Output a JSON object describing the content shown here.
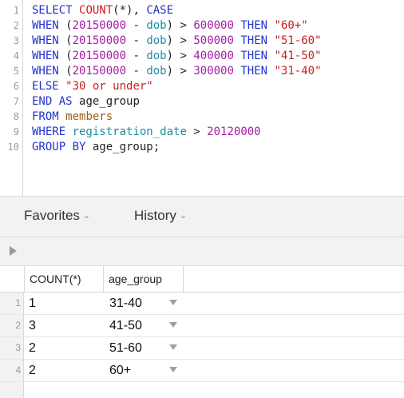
{
  "editor": {
    "line_numbers": [
      "1",
      "2",
      "3",
      "4",
      "5",
      "6",
      "7",
      "8",
      "9",
      "10"
    ],
    "lines": [
      [
        {
          "t": "SELECT ",
          "c": "kw"
        },
        {
          "t": "COUNT",
          "c": "fn"
        },
        {
          "t": "(*), ",
          "c": "op"
        },
        {
          "t": "CASE",
          "c": "kw"
        }
      ],
      [
        {
          "t": "WHEN ",
          "c": "kw"
        },
        {
          "t": "(",
          "c": "op"
        },
        {
          "t": "20150000",
          "c": "num"
        },
        {
          "t": " - ",
          "c": "op"
        },
        {
          "t": "dob",
          "c": "col"
        },
        {
          "t": ") > ",
          "c": "op"
        },
        {
          "t": "600000",
          "c": "num"
        },
        {
          "t": " THEN ",
          "c": "kw"
        },
        {
          "t": "\"60+\"",
          "c": "str"
        }
      ],
      [
        {
          "t": "WHEN ",
          "c": "kw"
        },
        {
          "t": "(",
          "c": "op"
        },
        {
          "t": "20150000",
          "c": "num"
        },
        {
          "t": " - ",
          "c": "op"
        },
        {
          "t": "dob",
          "c": "col"
        },
        {
          "t": ") > ",
          "c": "op"
        },
        {
          "t": "500000",
          "c": "num"
        },
        {
          "t": " THEN ",
          "c": "kw"
        },
        {
          "t": "\"51-60\"",
          "c": "str"
        }
      ],
      [
        {
          "t": "WHEN ",
          "c": "kw"
        },
        {
          "t": "(",
          "c": "op"
        },
        {
          "t": "20150000",
          "c": "num"
        },
        {
          "t": " - ",
          "c": "op"
        },
        {
          "t": "dob",
          "c": "col"
        },
        {
          "t": ") > ",
          "c": "op"
        },
        {
          "t": "400000",
          "c": "num"
        },
        {
          "t": " THEN ",
          "c": "kw"
        },
        {
          "t": "\"41-50\"",
          "c": "str"
        }
      ],
      [
        {
          "t": "WHEN ",
          "c": "kw"
        },
        {
          "t": "(",
          "c": "op"
        },
        {
          "t": "20150000",
          "c": "num"
        },
        {
          "t": " - ",
          "c": "op"
        },
        {
          "t": "dob",
          "c": "col"
        },
        {
          "t": ") > ",
          "c": "op"
        },
        {
          "t": "300000",
          "c": "num"
        },
        {
          "t": " THEN ",
          "c": "kw"
        },
        {
          "t": "\"31-40\"",
          "c": "str"
        }
      ],
      [
        {
          "t": "ELSE ",
          "c": "kw"
        },
        {
          "t": "\"30 or under\"",
          "c": "str"
        }
      ],
      [
        {
          "t": "END AS ",
          "c": "kw"
        },
        {
          "t": "age_group",
          "c": "ident"
        }
      ],
      [
        {
          "t": "FROM ",
          "c": "kw"
        },
        {
          "t": "members",
          "c": "tbl"
        }
      ],
      [
        {
          "t": "WHERE ",
          "c": "kw"
        },
        {
          "t": "registration_date",
          "c": "col"
        },
        {
          "t": " > ",
          "c": "op"
        },
        {
          "t": "20120000",
          "c": "num"
        }
      ],
      [
        {
          "t": "GROUP BY ",
          "c": "kw"
        },
        {
          "t": "age_group;",
          "c": "ident"
        }
      ]
    ]
  },
  "tabs": {
    "favorites_label": "Favorites",
    "history_label": "History"
  },
  "results": {
    "columns": [
      "COUNT(*)",
      "age_group"
    ],
    "rows": [
      {
        "num": "1",
        "count": "1",
        "age_group": "31-40"
      },
      {
        "num": "2",
        "count": "3",
        "age_group": "41-50"
      },
      {
        "num": "3",
        "count": "2",
        "age_group": "51-60"
      },
      {
        "num": "4",
        "count": "2",
        "age_group": "60+"
      }
    ]
  },
  "colors": {
    "keyword": "#2233cc",
    "function": "#d11a1a",
    "number": "#a31ea3",
    "string": "#c62121",
    "column": "#1f8aa6",
    "table": "#9a5b1e"
  }
}
